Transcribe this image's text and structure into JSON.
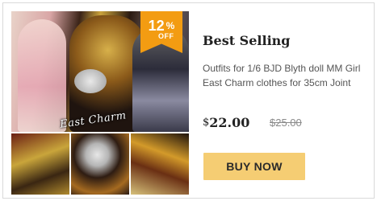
{
  "badge": {
    "percent": "12",
    "percent_symbol": "%",
    "off_label": "OFF"
  },
  "product": {
    "title": "Best Selling",
    "description": "Outfits for 1/6 BJD Blyth doll MM Girl East Charm clothes for 35cm Joint",
    "image_caption": "East Charm",
    "currency": "$",
    "price": "22.00",
    "old_price": "$25.00"
  },
  "actions": {
    "buy_label": "BUY NOW"
  },
  "colors": {
    "badge": "#f39c12",
    "buy_button": "#f5cd73"
  }
}
